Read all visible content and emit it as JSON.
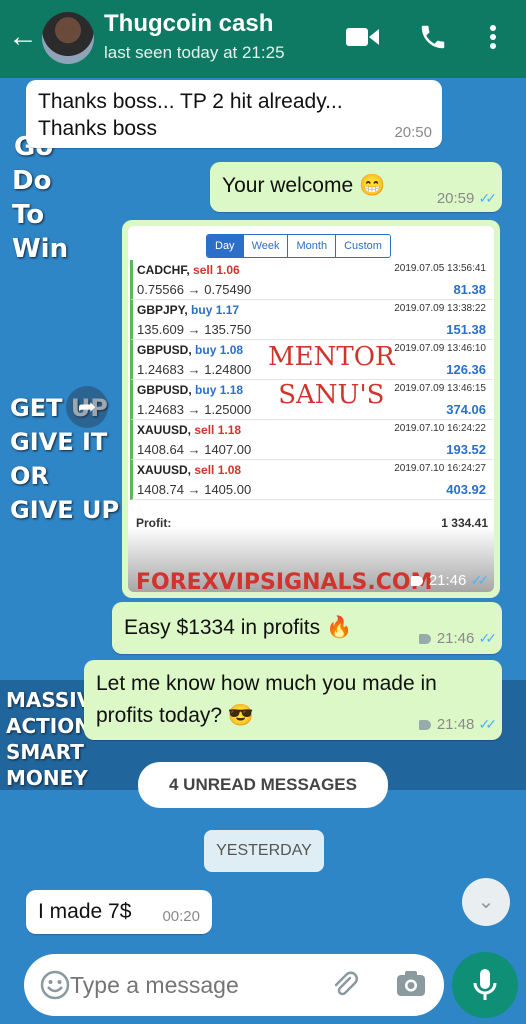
{
  "header": {
    "contact_name": "Thugcoin cash",
    "status": "last seen today at 21:25",
    "back_icon": "arrow-left-icon",
    "actions": [
      "video-call-icon",
      "phone-icon",
      "more-vert-icon"
    ]
  },
  "wallpaper": {
    "top_words": [
      "Go",
      "Do",
      "To",
      "Win"
    ],
    "middle_words": [
      "GET UP",
      "GIVE IT",
      "OR",
      "GIVE UP"
    ],
    "bottom_words": [
      "MASSIV",
      "ACTION",
      "SMART",
      "MONEY"
    ]
  },
  "messages": [
    {
      "dir": "in",
      "text": "Thanks boss... TP 2 hit already... Thanks boss",
      "time": "20:50"
    },
    {
      "dir": "out",
      "text": "Your welcome 😁",
      "time": "20:59",
      "ticks": "✓✓"
    },
    {
      "dir": "out",
      "type": "image",
      "time": "21:46",
      "ticks": "✓✓"
    },
    {
      "dir": "out",
      "text": "Easy $1334 in profits 🔥",
      "time": "21:46",
      "ticks": "✓✓"
    },
    {
      "dir": "out",
      "text": "Let me know how much you made in profits today? 😎",
      "time": "21:48",
      "ticks": "✓✓"
    },
    {
      "dir": "in",
      "text": "I made 7$",
      "time": "00:20"
    }
  ],
  "image_card": {
    "tabs": [
      "Day",
      "Week",
      "Month",
      "Custom"
    ],
    "active_tab": "Day",
    "trades": [
      {
        "symbol": "CADCHF,",
        "side": "sell",
        "lot": "1.06",
        "prices": "0.75566 → 0.75490",
        "datetime": "2019.07.05 13:56:41",
        "profit": "81.38"
      },
      {
        "symbol": "GBPJPY,",
        "side": "buy",
        "lot": "1.17",
        "prices": "135.609 → 135.750",
        "datetime": "2019.07.09 13:38:22",
        "profit": "151.38"
      },
      {
        "symbol": "GBPUSD,",
        "side": "buy",
        "lot": "1.08",
        "prices": "1.24683 → 1.24800",
        "datetime": "2019.07.09 13:46:10",
        "profit": "126.36"
      },
      {
        "symbol": "GBPUSD,",
        "side": "buy",
        "lot": "1.18",
        "prices": "1.24683 → 1.25000",
        "datetime": "2019.07.09 13:46:15",
        "profit": "374.06"
      },
      {
        "symbol": "XAUUSD,",
        "side": "sell",
        "lot": "1.18",
        "prices": "1408.64 → 1407.00",
        "datetime": "2019.07.10 16:24:22",
        "profit": "193.52"
      },
      {
        "symbol": "XAUUSD,",
        "side": "sell",
        "lot": "1.08",
        "prices": "1408.74 → 1405.00",
        "datetime": "2019.07.10 16:24:27",
        "profit": "403.92"
      }
    ],
    "profit_label": "Profit:",
    "profit_total": "1 334.41",
    "watermark_1": "MENTOR",
    "watermark_2": "SANU'S",
    "brand": "FOREXVIPSIGNALS.COM"
  },
  "unread_pill": "4 UNREAD MESSAGES",
  "date_pill": "YESTERDAY",
  "composer": {
    "placeholder": "Type a message",
    "emoji_icon": "emoji-icon",
    "attach_icon": "paperclip-icon",
    "camera_icon": "camera-icon",
    "mic_icon": "mic-icon"
  },
  "scroll_icon": "double-chevron-down-icon",
  "colors": {
    "header": "#0e7a63",
    "outgoing_bubble": "#dcf8c6",
    "incoming_bubble": "#ffffff",
    "read_ticks": "#4fb4f7",
    "mic_button": "#0e8f76",
    "wallpaper": "#2e86c7"
  }
}
